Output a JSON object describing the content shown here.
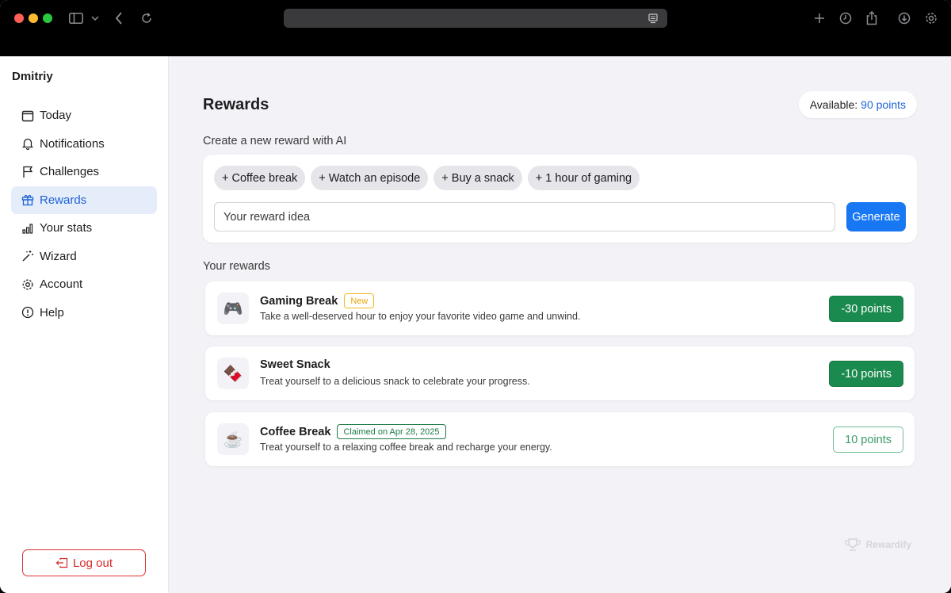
{
  "browser": {
    "address": ""
  },
  "sidebar": {
    "user_name": "Dmitriy",
    "items": [
      {
        "label": "Today",
        "icon": "calendar-icon"
      },
      {
        "label": "Notifications",
        "icon": "bell-icon"
      },
      {
        "label": "Challenges",
        "icon": "flag-icon"
      },
      {
        "label": "Rewards",
        "icon": "gift-icon",
        "active": true
      },
      {
        "label": "Your stats",
        "icon": "bar-chart-icon"
      },
      {
        "label": "Wizard",
        "icon": "magic-wand-icon"
      },
      {
        "label": "Account",
        "icon": "gear-icon"
      },
      {
        "label": "Help",
        "icon": "help-circle-icon"
      }
    ],
    "logout_label": "Log out"
  },
  "main": {
    "title": "Rewards",
    "available_label": "Available:",
    "available_points": "90 points",
    "create_label": "Create a new reward with AI",
    "chips": [
      "+ Coffee break",
      "+ Watch an episode",
      "+ Buy a snack",
      "+ 1 hour of gaming"
    ],
    "input_placeholder": "Your reward idea",
    "generate_label": "Generate",
    "rewards_label": "Your rewards",
    "rewards": [
      {
        "emoji": "🎮",
        "title": "Gaming Break",
        "badge": "New",
        "desc": "Take a well-deserved hour to enjoy your favorite video game and unwind.",
        "points": "-30 points"
      },
      {
        "emoji": "🍫",
        "title": "Sweet Snack",
        "badge": "",
        "desc": "Treat yourself to a delicious snack to celebrate your progress.",
        "points": "-10 points"
      },
      {
        "emoji": "☕",
        "title": "Coffee Break",
        "badge": "Claimed on Apr 28, 2025",
        "desc": "Treat yourself to a relaxing coffee break and recharge your energy.",
        "points": "10 points"
      }
    ],
    "brand": "Rewardify"
  },
  "colors": {
    "accent": "#1e63d6",
    "primary_button": "#1877f2",
    "success": "#1a8a4e",
    "danger": "#d62b2b",
    "badge_new": "#e8a60a"
  }
}
